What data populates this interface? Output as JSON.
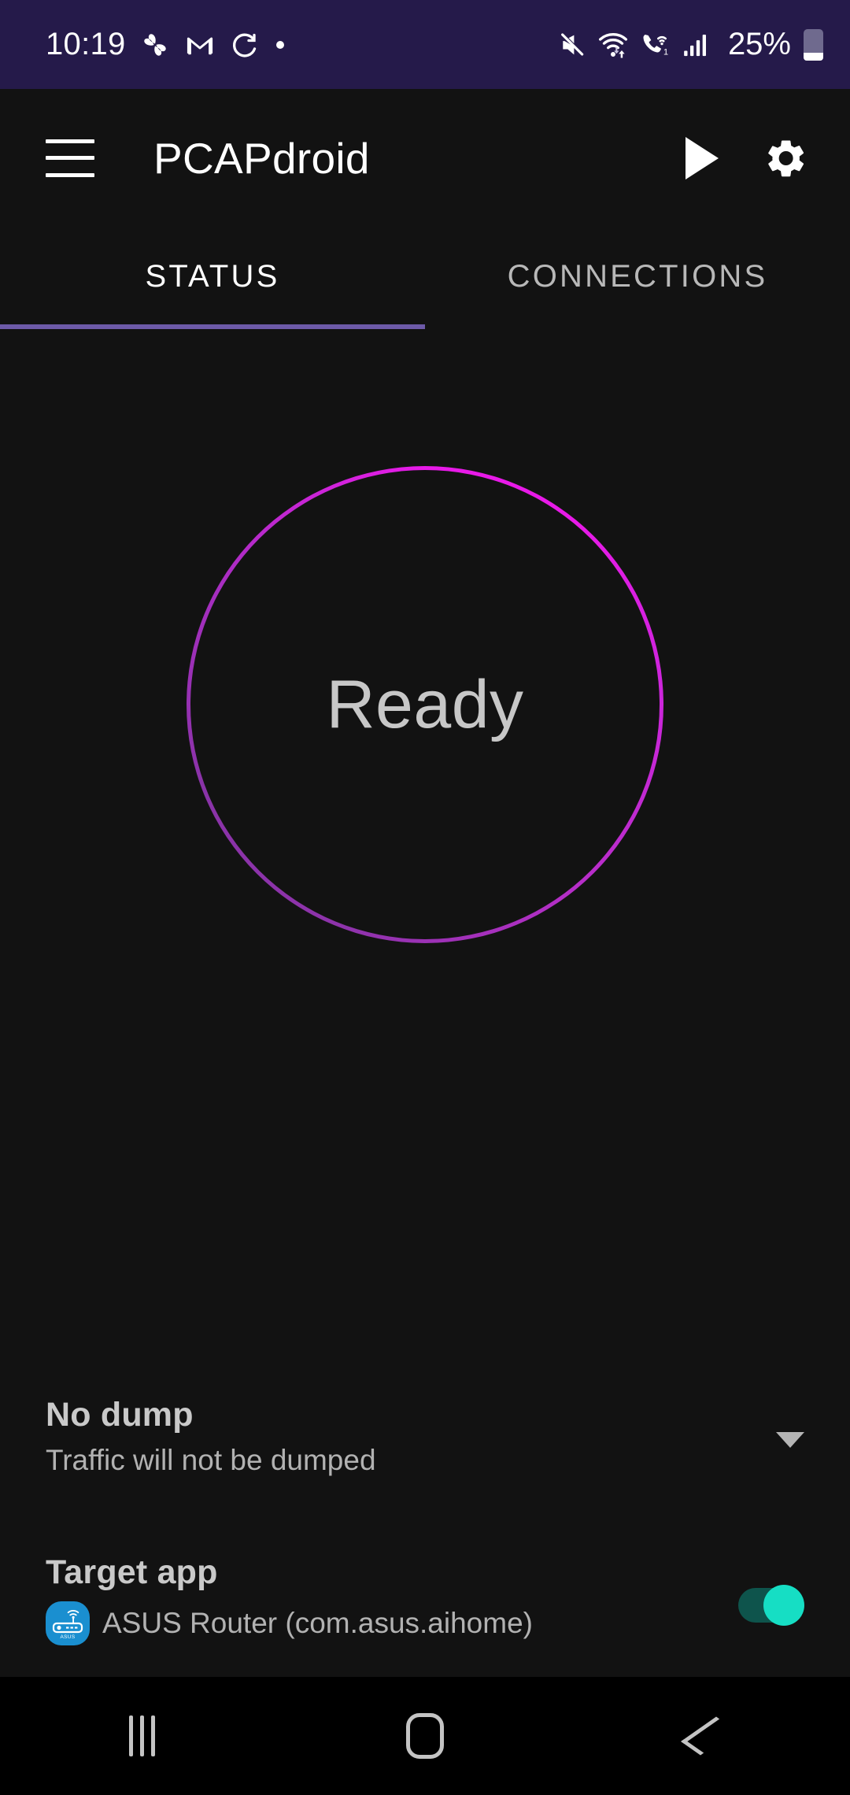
{
  "statusbar": {
    "time": "10:19",
    "battery_percent": "25%",
    "battery_level": 25,
    "background_color": "#251a4a",
    "left_icons": [
      "pinwheel-icon",
      "gmail-icon",
      "sync-icon",
      "dot-icon"
    ],
    "right_icons": [
      "mute-icon",
      "wifi-icon",
      "call-wifi-icon",
      "signal-bars-icon",
      "battery-icon"
    ]
  },
  "appbar": {
    "menu_icon": "hamburger-menu-icon",
    "title": "PCAPdroid",
    "play_icon": "play-icon",
    "settings_icon": "gear-icon"
  },
  "tabs": {
    "items": [
      {
        "label": "STATUS",
        "active": true
      },
      {
        "label": "CONNECTIONS",
        "active": false
      }
    ],
    "indicator_color": "#6d5aa8"
  },
  "main": {
    "status_circle": {
      "label": "Ready",
      "gradient_from": "#8a33a8",
      "gradient_to": "#e81ae8"
    },
    "dump_row": {
      "title": "No dump",
      "subtitle": "Traffic will not be dumped",
      "caret_icon": "chevron-down-icon"
    },
    "target_app_row": {
      "title": "Target app",
      "app_icon": "asus-router-app-icon",
      "app_label": "ASUS Router (com.asus.aihome)",
      "toggle_on": true,
      "toggle_color": "#16dec4"
    }
  },
  "navbar": {
    "recents_icon": "recents-icon",
    "home_icon": "home-icon",
    "back_icon": "back-icon"
  }
}
